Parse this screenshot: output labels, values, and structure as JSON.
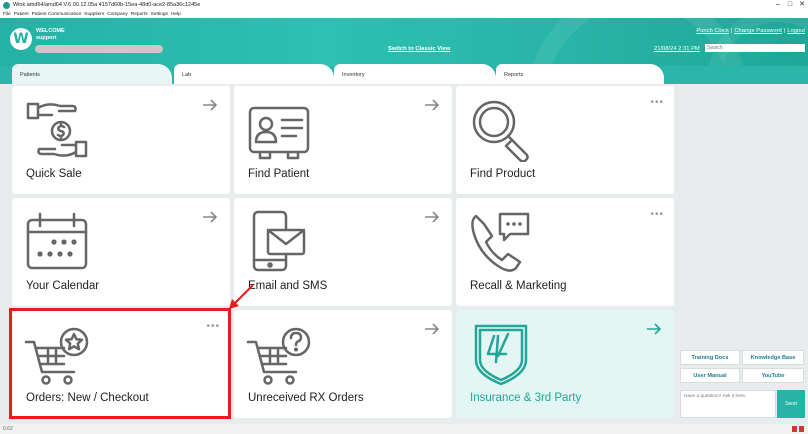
{
  "window": {
    "title": "Wink amd64/amd64 V.6.00.12.05a 4157d60b-15ea-48d0-ace2-85a36c1245e",
    "controls": [
      "–",
      "□",
      "✕"
    ]
  },
  "menu": [
    "File",
    "Patient",
    "Patient Communication",
    "Suppliers",
    "Company",
    "Reports",
    "Settings",
    "Help"
  ],
  "header": {
    "logo_letter": "W",
    "welcome": "WELCOME",
    "role": "support",
    "classic_view": "Switch to Classic View",
    "punch_clock": "Punch Clock",
    "change_password": "Change Password",
    "logout": "Logout",
    "separator": "|",
    "datetime": "21/08/24 2:31 PM",
    "search_placeholder": "Search"
  },
  "tabs": [
    "Patients",
    "Lab",
    "Inventory",
    "Reports"
  ],
  "tiles": [
    {
      "label": "Quick Sale",
      "icon": "hand-dollar-icon",
      "corner": "arrow"
    },
    {
      "label": "Find Patient",
      "icon": "id-card-icon",
      "corner": "arrow"
    },
    {
      "label": "Find Product",
      "icon": "magnifier-icon",
      "corner": "dots"
    },
    {
      "label": "Your Calendar",
      "icon": "calendar-icon",
      "corner": "arrow"
    },
    {
      "label": "Email and SMS",
      "icon": "phone-mail-icon",
      "corner": "arrow"
    },
    {
      "label": "Recall & Marketing",
      "icon": "phone-chat-icon",
      "corner": "dots"
    },
    {
      "label": "Orders: New / Checkout",
      "icon": "cart-star-icon",
      "corner": "dots"
    },
    {
      "label": "Unreceived RX Orders",
      "icon": "cart-question-icon",
      "corner": "arrow"
    },
    {
      "label": "Insurance & 3rd Party",
      "icon": "shield-icon",
      "corner": "arrow"
    }
  ],
  "help": {
    "training_docs": "Training Docs",
    "knowledge_base": "Knowledge Base",
    "user_manual": "User Manual",
    "youtube": "YouTube",
    "ask_placeholder": "Have a question? Ask it here.",
    "send": "Send"
  },
  "status": {
    "version": "0.62"
  },
  "colors": {
    "brand_teal": "#2ab6a8",
    "highlight_red": "#e41d1d",
    "tile_bg": "#ffffff",
    "main_bg": "#e9ecec"
  }
}
